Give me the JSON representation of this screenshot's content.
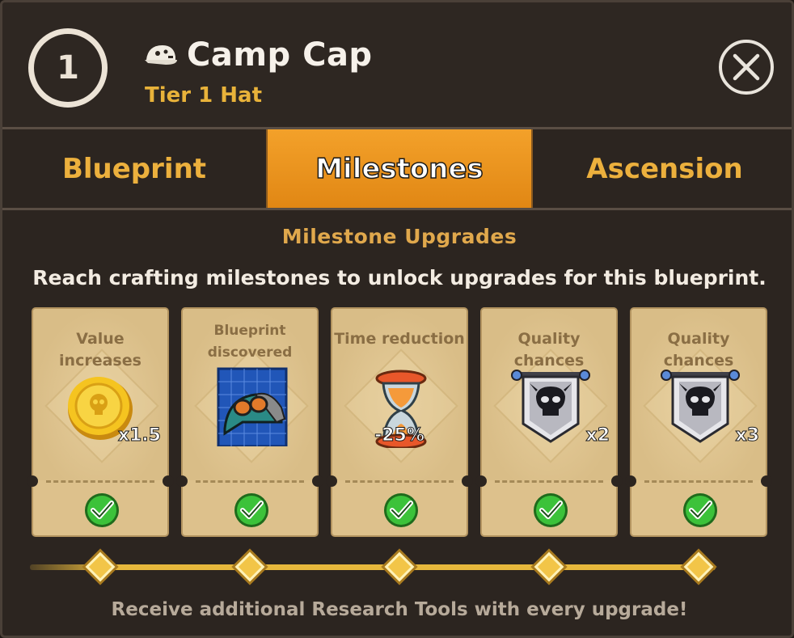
{
  "header": {
    "tier_number": "1",
    "title": "Camp Cap",
    "subtitle": "Tier 1 Hat",
    "item_icon": "cap-icon",
    "close_icon": "close-icon"
  },
  "tabs": [
    {
      "label": "Blueprint",
      "active": false
    },
    {
      "label": "Milestones",
      "active": true
    },
    {
      "label": "Ascension",
      "active": false
    }
  ],
  "section": {
    "title": "Milestone Upgrades",
    "description": "Reach crafting milestones to unlock upgrades for this blueprint."
  },
  "milestones": [
    {
      "label": "Value increases",
      "icon": "gold-coin-icon",
      "value": "x1.5",
      "completed": true
    },
    {
      "label": "Blueprint discovered",
      "icon": "cap-blueprint-icon",
      "value": "",
      "completed": true
    },
    {
      "label": "Time reduction",
      "icon": "hourglass-icon",
      "value": "-25%",
      "completed": true
    },
    {
      "label": "Quality chances",
      "icon": "skull-banner-icon",
      "value": "x2",
      "completed": true
    },
    {
      "label": "Quality chances",
      "icon": "skull-banner-icon",
      "value": "x3",
      "completed": true
    }
  ],
  "progress": {
    "completed_nodes": 5,
    "total_nodes": 5
  },
  "footer": {
    "text": "Receive additional Research Tools with every upgrade!"
  },
  "colors": {
    "accent_orange": "#f3a12a",
    "gold_text": "#ecb03d",
    "card_bg": "#ddc18c",
    "check_green": "#3cc23a"
  }
}
